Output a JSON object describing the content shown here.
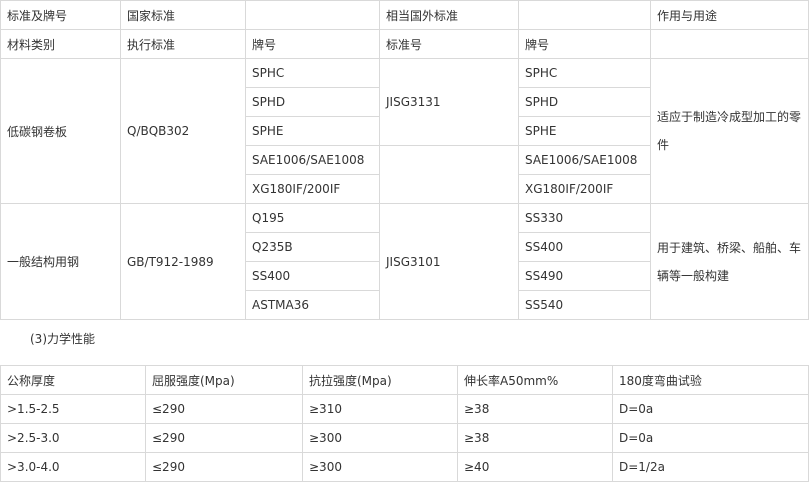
{
  "standards_table": {
    "header1": {
      "grade": "标准及牌号",
      "national": "国家标准",
      "foreign": "相当国外标准",
      "usage": "作用与用途"
    },
    "header2": {
      "material": "材料类别",
      "exec_standard": "执行标准",
      "brand": "牌号",
      "standard_no": "标准号",
      "foreign_brand": "牌号"
    },
    "group1": {
      "material": "低碳钢卷板",
      "exec_standard": "Q/BQB302",
      "brands": [
        "SPHC",
        "SPHD",
        "SPHE",
        "SAE1006/SAE1008",
        "XG180IF/200IF"
      ],
      "foreign_standard": "JISG3131",
      "foreign_brands": [
        "SPHC",
        "SPHD",
        "SPHE",
        "SAE1006/SAE1008",
        "XG180IF/200IF"
      ],
      "usage": "适应于制造冷成型加工的零件"
    },
    "group2": {
      "material": "一般结构用钢",
      "exec_standard": "GB/T912-1989",
      "brands": [
        "Q195",
        "Q235B",
        "SS400",
        "ASTMA36"
      ],
      "foreign_standard": "JISG3101",
      "foreign_brands": [
        "SS330",
        "SS400",
        "SS490",
        "SS540"
      ],
      "usage": "用于建筑、桥梁、船舶、车辆等一般构建"
    }
  },
  "section_title": "(3)力学性能",
  "mechanical_table": {
    "headers": [
      "公称厚度",
      "屈服强度(Mpa)",
      "抗拉强度(Mpa)",
      "伸长率A50mm%",
      "180度弯曲试验"
    ],
    "rows": [
      [
        ">1.5-2.5",
        "≤290",
        "≥310",
        "≥38",
        "D=0a"
      ],
      [
        ">2.5-3.0",
        "≤290",
        "≥300",
        "≥38",
        "D=0a"
      ],
      [
        ">3.0-4.0",
        "≤290",
        "≥300",
        "≥40",
        "D=1/2a"
      ]
    ]
  }
}
